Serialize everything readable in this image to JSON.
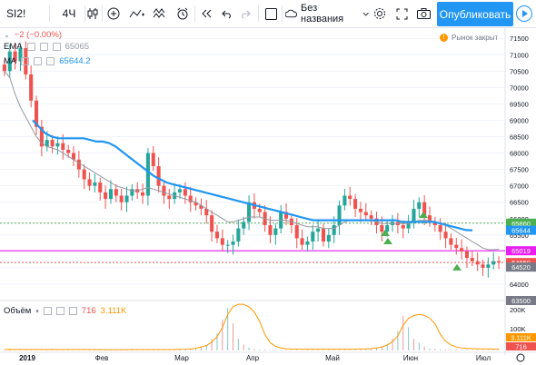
{
  "toolbar": {
    "symbol": "SI2!",
    "interval": "4Ч",
    "layout_name": "Без названия",
    "publish_label": "Опубликовать"
  },
  "legend": {
    "change": "−2 (−0.00%)",
    "ema_name": "EMA",
    "ema_value": "65065",
    "ma_name": "MA",
    "ma_value": "65644.2"
  },
  "market_status": "Рынок закрыт",
  "colors": {
    "accent": "#2196f3",
    "up": "#26a69a",
    "down": "#ef5350",
    "ema": "#9598a1",
    "ma": "#2196f3",
    "magenta": "#e91ef0",
    "green_line": "#4caf50"
  },
  "price_axis": {
    "ticks": [
      "71500",
      "71000",
      "70500",
      "70000",
      "69500",
      "69000",
      "68500",
      "68000",
      "67500",
      "67000",
      "66500",
      "66000",
      "65500",
      "65000",
      "64500",
      "64000",
      "63500"
    ],
    "labels": [
      {
        "text": "65860",
        "color": "#4caf50"
      },
      {
        "text": "65644",
        "color": "#2196f3"
      },
      {
        "text": "65019",
        "color": "#e91ef0"
      },
      {
        "text": "64659",
        "color": "#ef5350"
      },
      {
        "text": "64520",
        "color": "#787b86"
      },
      {
        "text": "63500",
        "color": "#787b86"
      }
    ]
  },
  "time_axis": [
    "2019",
    "Фев",
    "Мар",
    "Апр",
    "Май",
    "Июн",
    "Июл"
  ],
  "volume": {
    "name": "Объём",
    "value": "716",
    "ma_value": "3.111K",
    "ticks": [
      "200K",
      "100K"
    ],
    "labels": [
      {
        "text": "3.111K",
        "color": "#ff9800"
      },
      {
        "text": "716",
        "color": "#ef5350"
      }
    ]
  },
  "chart_data": {
    "type": "candlestick",
    "ylim": [
      63500,
      71700
    ],
    "close_series": [
      70500,
      71100,
      70800,
      71200,
      70400,
      69600,
      68800,
      68200,
      68400,
      68200,
      68300,
      68100,
      68000,
      67800,
      67500,
      67200,
      67000,
      67100,
      66800,
      66600,
      66900,
      66700,
      66500,
      66700,
      66900,
      66800,
      66700,
      68000,
      67600,
      67000,
      66700,
      66600,
      66800,
      66900,
      66700,
      66500,
      66400,
      66300,
      66100,
      65600,
      65400,
      65200,
      65200,
      65300,
      65700,
      65900,
      66500,
      66300,
      66200,
      65800,
      65500,
      65700,
      66200,
      66000,
      65800,
      65400,
      65200,
      65300,
      65600,
      65700,
      65300,
      65500,
      65800,
      66400,
      66700,
      66600,
      66300,
      66200,
      66100,
      66000,
      65800,
      65600,
      65800,
      65900,
      65800,
      65700,
      65900,
      66300,
      66500,
      66100,
      65900,
      65800,
      65600,
      65400,
      65200,
      65100,
      65000,
      64800,
      64700,
      64600,
      64500,
      64600,
      64700,
      64660
    ],
    "ema_series": [
      70500,
      70300,
      69800,
      69400,
      69100,
      68800,
      68500,
      68300,
      68200,
      68150,
      68100,
      68000,
      67900,
      67800,
      67700,
      67600,
      67500,
      67400,
      67300,
      67200,
      67100,
      67000,
      66950,
      66900,
      66850,
      66850,
      66900,
      66950,
      66900,
      66850,
      66800,
      66750,
      66700,
      66650,
      66600,
      66550,
      66500,
      66400,
      66300,
      66200,
      66100,
      66000,
      65900,
      65900,
      65950,
      66000,
      66050,
      66050,
      66050,
      66000,
      65950,
      65950,
      65950,
      65950,
      65900,
      65850,
      65800,
      65750,
      65750,
      65750,
      65700,
      65700,
      65700,
      65800,
      65900,
      65950,
      65950,
      65950,
      65950,
      65950,
      65900,
      65850,
      65850,
      65850,
      65850,
      65850,
      65850,
      65900,
      65950,
      65950,
      65950,
      65900,
      65850,
      65800,
      65700,
      65600,
      65500,
      65400,
      65300,
      65200,
      65100,
      65050,
      65050,
      65065
    ],
    "ma_series": [
      69000,
      68800,
      68600,
      68500,
      68450,
      68450,
      68450,
      68450,
      68450,
      68400,
      68350,
      68350,
      68300,
      68200,
      68050,
      67900,
      67750,
      67600,
      67450,
      67300,
      67200,
      67100,
      67050,
      67000,
      66950,
      66900,
      66850,
      66800,
      66750,
      66700,
      66650,
      66600,
      66550,
      66500,
      66450,
      66400,
      66350,
      66300,
      66250,
      66200,
      66150,
      66100,
      66050,
      66000,
      65950,
      65950,
      65950,
      65950,
      65950,
      65950,
      65950,
      65950,
      65950,
      65950,
      65950,
      65950,
      65950,
      65950,
      65900,
      65900,
      65900,
      65900,
      65900,
      65900,
      65850,
      65800,
      65750,
      65700,
      65650,
      65644
    ],
    "levels": [
      {
        "value": 65860,
        "color": "#4caf50",
        "style": "dotted"
      },
      {
        "value": 65019,
        "color": "#e91ef0",
        "style": "solid"
      },
      {
        "value": 64659,
        "color": "#ef5350",
        "style": "dotted"
      }
    ],
    "volume_series": [
      2,
      3,
      2,
      2,
      3,
      2,
      2,
      2,
      2,
      3,
      2,
      2,
      3,
      2,
      2,
      2,
      2,
      2,
      2,
      2,
      2,
      2,
      2,
      2,
      3,
      2,
      2,
      2,
      2,
      2,
      2,
      3,
      3,
      4,
      5,
      8,
      12,
      20,
      30,
      60,
      90,
      160,
      220,
      140,
      60,
      30,
      15,
      8,
      5,
      4,
      3,
      3,
      3,
      3,
      3,
      3,
      3,
      3,
      3,
      3,
      3,
      3,
      3,
      3,
      3,
      3,
      4,
      5,
      6,
      8,
      12,
      20,
      35,
      60,
      100,
      180,
      120,
      60,
      40,
      20,
      10,
      8,
      6,
      5,
      4,
      4,
      4,
      4,
      3,
      3,
      3,
      3,
      3,
      3
    ],
    "volume_ylim": [
      0,
      230
    ]
  }
}
